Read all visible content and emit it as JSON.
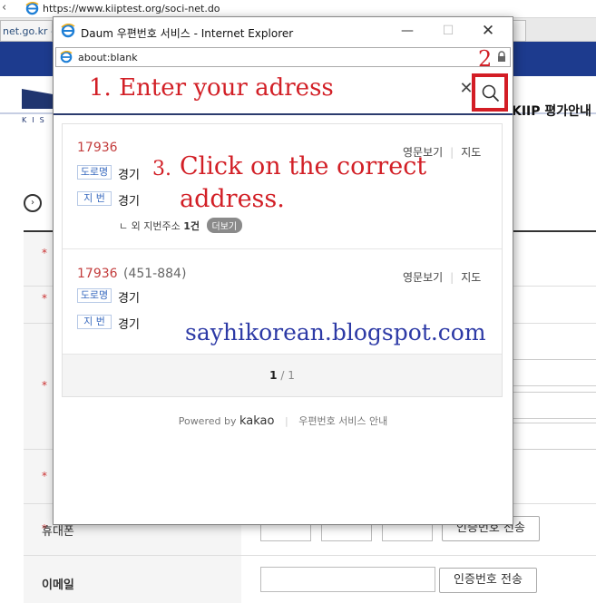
{
  "background_page": {
    "url": "https://www.kiiptest.org/soci-net.do",
    "tab_label": "net.go.kr -",
    "header_right": "KIIP 평가안내",
    "logo_letters": "KIS",
    "phone_label": "휴대폰",
    "email_label": "이메일",
    "verify_button": "인증번호 전송",
    "required_star": "*"
  },
  "popup": {
    "window_title": "Daum 우편번호 서비스 - Internet Explorer",
    "address": "about:blank",
    "results": [
      {
        "zipcode": "17936",
        "old_zipcode": "",
        "road_tag": "도로명",
        "road_address": "경기",
        "lot_tag": "지 번",
        "lot_address": "경기",
        "more_text": "ㄴ 외 지번주소",
        "more_count": "1건",
        "more_button": "더보기",
        "link_english": "영문보기",
        "link_map": "지도"
      },
      {
        "zipcode": "17936",
        "old_zipcode": "(451-884)",
        "road_tag": "도로명",
        "road_address": "경기",
        "lot_tag": "지 번",
        "lot_address": "경기",
        "link_english": "영문보기",
        "link_map": "지도"
      }
    ],
    "pagination": {
      "current": "1",
      "separator": "/",
      "total": "1"
    },
    "footer": {
      "powered_by": "Powered by",
      "brand": "kakao",
      "guide_link": "우편번호 서비스 안내"
    }
  },
  "annotations": {
    "step1": "1. Enter your adress",
    "step2": "2",
    "step3_number": "3.",
    "step3_line1": "Click on the correct",
    "step3_line2": "address.",
    "watermark": "sayhikorean.blogspot.com"
  },
  "colors": {
    "annotation_red": "#d21f26",
    "zip_red": "#c33c3c",
    "tag_blue": "#3a6bbf",
    "banner_navy": "#1d3b8e",
    "watermark_blue": "#2d3aa6"
  }
}
